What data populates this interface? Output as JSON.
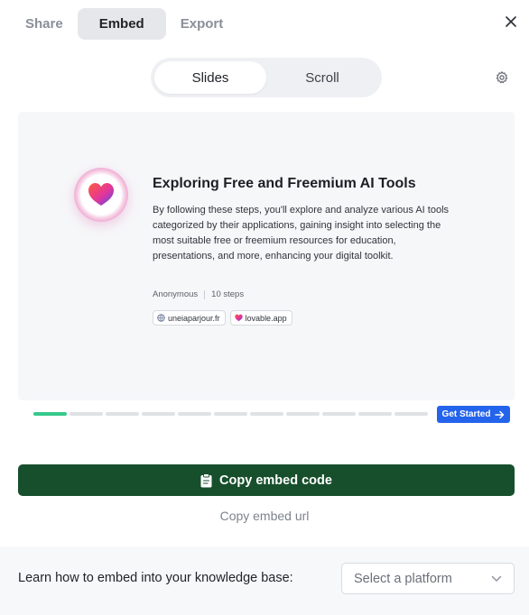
{
  "tabs": [
    {
      "label": "Share",
      "active": false
    },
    {
      "label": "Embed",
      "active": true
    },
    {
      "label": "Export",
      "active": false
    }
  ],
  "view_toggle": {
    "slides_label": "Slides",
    "scroll_label": "Scroll",
    "selected": "Slides"
  },
  "preview": {
    "title": "Exploring Free and Freemium AI Tools",
    "description": "By following these steps, you'll explore and analyze various AI tools categorized by their applications, gaining insight into selecting the most suitable free or freemium resources for education, presentations, and more, enhancing your digital toolkit.",
    "author": "Anonymous",
    "steps": "10 steps",
    "sources": [
      {
        "label": "uneiaparjour.fr",
        "icon": "globe-icon"
      },
      {
        "label": "lovable.app",
        "icon": "heart-icon"
      }
    ],
    "progress": {
      "current_step": 1,
      "total_steps": 11
    },
    "cta_label": "Get Started"
  },
  "actions": {
    "copy_code_label": "Copy embed code",
    "copy_url_label": "Copy embed url"
  },
  "footer": {
    "label": "Learn how to embed into your knowledge base:",
    "select_placeholder": "Select a platform"
  },
  "colors": {
    "primary_green": "#174f2c",
    "progress_green": "#36c98c",
    "cta_blue": "#2463eb"
  }
}
